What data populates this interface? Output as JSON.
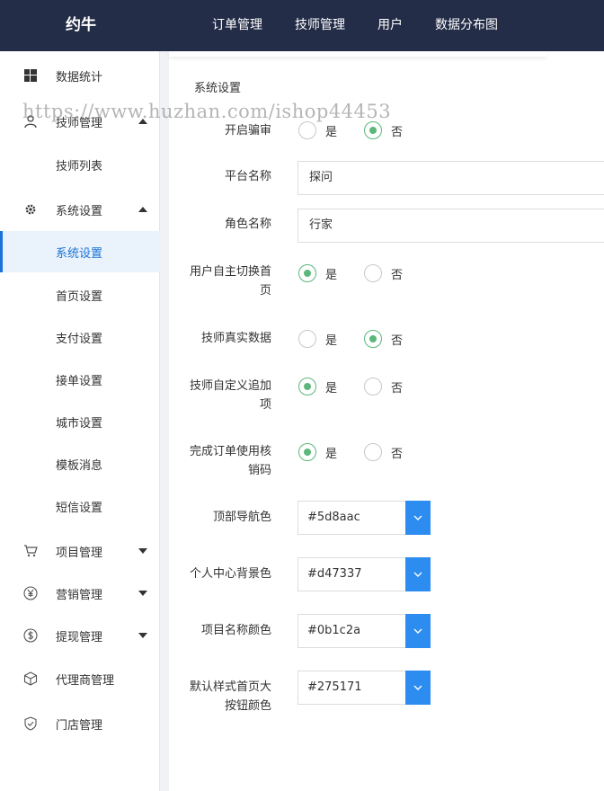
{
  "header": {
    "brand": "约牛",
    "nav": [
      "订单管理",
      "技师管理",
      "用户",
      "数据分布图"
    ]
  },
  "sidebar": {
    "items": [
      {
        "label": "数据统计",
        "icon": "windows-icon"
      },
      {
        "label": "技师管理",
        "icon": "person-icon",
        "caret": "up"
      },
      {
        "label": "技师列表"
      },
      {
        "label": "系统设置",
        "icon": "gear-icon",
        "caret": "up"
      },
      {
        "label": "系统设置",
        "active": true
      },
      {
        "label": "首页设置"
      },
      {
        "label": "支付设置"
      },
      {
        "label": "接单设置"
      },
      {
        "label": "城市设置"
      },
      {
        "label": "模板消息"
      },
      {
        "label": "短信设置"
      },
      {
        "label": "项目管理",
        "icon": "cart-icon",
        "caret": "down"
      },
      {
        "label": "营销管理",
        "icon": "yen-icon",
        "caret": "down"
      },
      {
        "label": "提现管理",
        "icon": "dollar-icon",
        "caret": "down"
      },
      {
        "label": "代理商管理",
        "icon": "cube-icon"
      },
      {
        "label": "门店管理",
        "icon": "shield-icon"
      }
    ]
  },
  "main": {
    "section_title": "系统设置",
    "radio_options": {
      "yes": "是",
      "no": "否"
    },
    "fields": {
      "review": {
        "label": "开启骗审",
        "value": "no"
      },
      "platform_name": {
        "label": "平台名称",
        "value": "探问"
      },
      "role_name": {
        "label": "角色名称",
        "value": "行家"
      },
      "user_switch_home": {
        "label_line1": "用户自主切换首",
        "label_line2": "页",
        "value": "yes"
      },
      "tech_real_data": {
        "label": "技师真实数据",
        "value": "no"
      },
      "tech_custom_add": {
        "label_line1": "技师自定义追加",
        "label_line2": "项",
        "value": "yes"
      },
      "complete_order_code": {
        "label_line1": "完成订单使用核",
        "label_line2": "销码",
        "value": "yes"
      },
      "top_nav_color": {
        "label": "顶部导航色",
        "value": "#5d8aac"
      },
      "user_center_bg": {
        "label": "个人中心背景色",
        "value": "#d47337"
      },
      "project_name_color": {
        "label": "项目名称颜色",
        "value": "#0b1c2a"
      },
      "home_button_color": {
        "label_line1": "默认样式首页大",
        "label_line2": "按钮颜色",
        "value": "#275171"
      }
    }
  },
  "watermark": "https://www.huzhan.com/ishop44453",
  "colors": {
    "topbar": "#242d48",
    "accent_blue": "#2d8cf0",
    "radio_green": "#5bb87a",
    "active_bg": "#eaf2fb"
  }
}
